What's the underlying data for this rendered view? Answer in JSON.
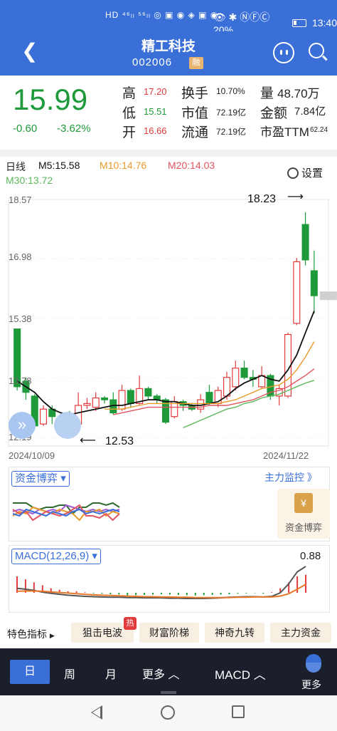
{
  "status_bar": {
    "left_text": "HD ⁴⁶ₗₗ ⁵⁶ₗₗ ◎ ▣ ◉ ◈ ▣ ◉ ·",
    "right_text": "👁 ✱ ⓃⒻⒸ 20%",
    "battery": "20%",
    "time": "13:40"
  },
  "header": {
    "back_icon": "chevron-left-icon",
    "title": "精工科技",
    "code": "002006",
    "margin_badge": "融",
    "face_icon": "face-icon",
    "search_icon": "search-icon"
  },
  "quote": {
    "price": "15.99",
    "change": "-0.60",
    "change_pct": "-3.62%",
    "high_label": "高",
    "high": "17.20",
    "low_label": "低",
    "low": "15.51",
    "open_label": "开",
    "open": "16.66",
    "turnover_label": "换手",
    "turnover": "10.70%",
    "mktcap_label": "市值",
    "mktcap": "72.19亿",
    "float_label": "流通",
    "float_cap": "72.19亿",
    "volume_label": "量",
    "volume": "48.70万",
    "amount_label": "金额",
    "amount": "7.84亿",
    "pe_label": "市盈TTM",
    "pe": "62.24",
    "colors": {
      "up": "#e23b3b",
      "down": "#1e9a3a"
    }
  },
  "kline": {
    "period_label": "日线",
    "ma5": "M5:15.58",
    "ma10": "M10:14.76",
    "ma20": "M20:14.03",
    "ma30": "M30:13.72",
    "settings_label": "设置",
    "y_top": "18.57",
    "y_2": "16.98",
    "y_3": "15.38",
    "y_4": "13.78",
    "y_bottom": "12.19",
    "x_start": "2024/10/09",
    "x_end": "2024/11/22",
    "max_annotation": "18.23",
    "min_annotation": "12.53"
  },
  "capital": {
    "dropdown": "资金博弈",
    "monitor_link": "主力监控 》",
    "card_label": "资金博弈"
  },
  "macd": {
    "dropdown": "MACD(12,26,9)",
    "value": "0.88"
  },
  "chips": {
    "tese": "特色指标",
    "c1": "狙击电波",
    "hot": "热",
    "c2": "财富阶梯",
    "c3": "神奇九转",
    "c4": "主力资金"
  },
  "toolbar": {
    "day": "日",
    "week": "周",
    "month": "月",
    "more_period": "更多 ︿",
    "indicator": "MACD ︿",
    "more": "更多"
  },
  "chart_data": {
    "type": "candlestick",
    "y_range": [
      12.19,
      18.57
    ],
    "y_ticks": [
      18.57,
      16.98,
      15.38,
      13.78,
      12.19
    ],
    "x_labels": [
      "2024/10/09",
      "2024/11/22"
    ],
    "candles": [
      {
        "o": 15.1,
        "c": 13.55,
        "h": 15.1,
        "l": 13.45
      },
      {
        "o": 13.7,
        "c": 13.4,
        "h": 13.8,
        "l": 13.2
      },
      {
        "o": 13.3,
        "c": 12.5,
        "h": 13.35,
        "l": 12.45
      },
      {
        "o": 12.55,
        "c": 12.95,
        "h": 13.05,
        "l": 12.5
      },
      {
        "o": 12.95,
        "c": 12.75,
        "h": 13.05,
        "l": 12.55
      },
      {
        "o": 12.7,
        "c": 12.65,
        "h": 12.8,
        "l": 12.53
      },
      {
        "o": 12.7,
        "c": 12.55,
        "h": 12.9,
        "l": 12.45
      },
      {
        "o": 12.55,
        "c": 13.05,
        "h": 13.4,
        "l": 12.45
      },
      {
        "o": 13.05,
        "c": 13.1,
        "h": 13.25,
        "l": 12.95
      },
      {
        "o": 13.0,
        "c": 13.25,
        "h": 13.4,
        "l": 12.9
      },
      {
        "o": 13.25,
        "c": 13.2,
        "h": 13.3,
        "l": 13.1
      },
      {
        "o": 13.2,
        "c": 12.85,
        "h": 13.4,
        "l": 12.8
      },
      {
        "o": 12.95,
        "c": 13.45,
        "h": 13.6,
        "l": 12.9
      },
      {
        "o": 13.45,
        "c": 13.1,
        "h": 13.5,
        "l": 13.0
      },
      {
        "o": 13.1,
        "c": 13.5,
        "h": 13.85,
        "l": 13.05
      },
      {
        "o": 13.5,
        "c": 13.3,
        "h": 13.55,
        "l": 13.2
      },
      {
        "o": 13.3,
        "c": 13.2,
        "h": 13.35,
        "l": 13.1
      },
      {
        "o": 13.2,
        "c": 12.6,
        "h": 13.25,
        "l": 12.55
      },
      {
        "o": 12.75,
        "c": 13.15,
        "h": 13.3,
        "l": 12.7
      },
      {
        "o": 13.15,
        "c": 13.05,
        "h": 13.2,
        "l": 12.9
      },
      {
        "o": 13.05,
        "c": 12.95,
        "h": 13.1,
        "l": 12.9
      },
      {
        "o": 12.95,
        "c": 13.2,
        "h": 13.35,
        "l": 12.85
      },
      {
        "o": 13.4,
        "c": 13.1,
        "h": 13.6,
        "l": 13.05
      },
      {
        "o": 13.1,
        "c": 13.45,
        "h": 13.55,
        "l": 13.0
      },
      {
        "o": 13.3,
        "c": 13.8,
        "h": 13.95,
        "l": 13.2
      },
      {
        "o": 13.55,
        "c": 14.05,
        "h": 14.25,
        "l": 13.45
      },
      {
        "o": 14.05,
        "c": 13.8,
        "h": 14.25,
        "l": 13.75
      },
      {
        "o": 13.8,
        "c": 13.75,
        "h": 14.0,
        "l": 13.55
      },
      {
        "o": 13.55,
        "c": 13.85,
        "h": 14.1,
        "l": 13.5
      },
      {
        "o": 13.85,
        "c": 13.3,
        "h": 13.9,
        "l": 13.2
      },
      {
        "o": 13.3,
        "c": 13.5,
        "h": 13.6,
        "l": 13.05
      },
      {
        "o": 13.3,
        "c": 14.95,
        "h": 15.0,
        "l": 13.25
      },
      {
        "o": 15.25,
        "c": 16.9,
        "h": 17.0,
        "l": 15.2
      },
      {
        "o": 17.9,
        "c": 16.95,
        "h": 18.23,
        "l": 16.8
      },
      {
        "o": 16.66,
        "c": 15.99,
        "h": 17.2,
        "l": 15.51
      }
    ],
    "ma_lines": [
      {
        "name": "M5",
        "color": "#111111",
        "values": [
          13.7,
          13.55,
          13.4,
          13.15,
          12.95,
          12.85,
          12.8,
          12.85,
          12.9,
          12.95,
          13.0,
          13.05,
          13.05,
          13.1,
          13.15,
          13.2,
          13.2,
          13.15,
          13.15,
          13.1,
          13.05,
          13.05,
          13.1,
          13.15,
          13.3,
          13.5,
          13.65,
          13.75,
          13.85,
          13.75,
          13.7,
          14.0,
          14.4,
          15.0,
          15.58
        ]
      },
      {
        "name": "M10",
        "color": "#e89a2a",
        "values": [
          null,
          null,
          null,
          null,
          null,
          null,
          null,
          null,
          null,
          null,
          12.95,
          12.95,
          12.95,
          13.0,
          13.05,
          13.1,
          13.1,
          13.1,
          13.1,
          13.1,
          13.1,
          13.1,
          13.1,
          13.1,
          13.15,
          13.2,
          13.3,
          13.4,
          13.5,
          13.55,
          13.6,
          13.75,
          14.0,
          14.35,
          14.76
        ]
      },
      {
        "name": "M20",
        "color": "#e05560",
        "values": [
          null,
          null,
          null,
          null,
          null,
          null,
          null,
          null,
          null,
          null,
          null,
          12.8,
          12.85,
          12.9,
          12.95,
          13.0,
          13.0,
          13.0,
          13.0,
          13.0,
          13.0,
          13.0,
          13.05,
          13.05,
          13.05,
          13.1,
          13.15,
          13.2,
          13.3,
          13.4,
          13.45,
          13.55,
          13.7,
          13.85,
          14.03
        ]
      },
      {
        "name": "M30",
        "color": "#5cb85c",
        "values": [
          null,
          null,
          null,
          null,
          null,
          null,
          null,
          null,
          null,
          null,
          null,
          null,
          null,
          null,
          null,
          null,
          null,
          null,
          null,
          12.45,
          12.55,
          12.65,
          12.75,
          12.85,
          12.95,
          13.0,
          13.1,
          13.15,
          13.25,
          13.3,
          13.35,
          13.45,
          13.55,
          13.65,
          13.72
        ]
      }
    ],
    "capital_lines": [
      {
        "color": "#2e6b2e",
        "values": [
          0.3,
          0.3,
          0.3,
          0.4,
          0.45,
          0.4,
          0.4,
          0.35,
          0.35,
          0.55,
          0.4,
          0.4,
          0.3,
          0.3,
          0.35,
          0.3,
          0.4
        ]
      },
      {
        "color": "#a05bd6",
        "values": [
          0.5,
          0.45,
          0.5,
          0.55,
          0.45,
          0.5,
          0.45,
          0.5,
          0.35,
          0.4,
          0.45,
          0.5,
          0.45,
          0.5,
          0.45,
          0.5,
          0.45
        ]
      },
      {
        "color": "#e89a2a",
        "values": [
          0.6,
          0.5,
          0.55,
          0.4,
          0.45,
          0.5,
          0.55,
          0.45,
          0.5,
          0.55,
          0.7,
          0.5,
          0.5,
          0.45,
          0.6,
          0.5,
          0.55
        ]
      },
      {
        "color": "#e05560",
        "values": [
          0.45,
          0.55,
          0.5,
          0.7,
          0.6,
          0.5,
          0.55,
          0.6,
          0.55,
          0.45,
          0.35,
          0.6,
          0.6,
          0.65,
          0.55,
          0.7,
          0.55
        ]
      },
      {
        "color": "#3a6fd8",
        "values": [
          0.55,
          0.6,
          0.45,
          0.5,
          0.55,
          0.6,
          0.5,
          0.55,
          0.6,
          0.5,
          0.45,
          0.55,
          0.5,
          0.55,
          0.5,
          0.45,
          0.5
        ]
      }
    ],
    "macd_bars": [
      0.55,
      0.45,
      0.35,
      0.25,
      0.15,
      0.1,
      0.05,
      0.05,
      0.02,
      -0.02,
      -0.03,
      -0.05,
      -0.06,
      -0.08,
      -0.08,
      -0.07,
      -0.06,
      -0.05,
      -0.06,
      -0.07,
      -0.08,
      -0.09,
      -0.08,
      -0.07,
      -0.06,
      -0.05,
      -0.03,
      -0.02,
      -0.01,
      -0.03,
      0.02,
      0.15,
      0.35,
      0.55,
      0.6
    ],
    "macd_dif": [
      0.15,
      0.12,
      0.08,
      0.02,
      -0.02,
      -0.05,
      -0.08,
      -0.1,
      -0.12,
      -0.13,
      -0.14,
      -0.15,
      -0.15,
      -0.16,
      -0.16,
      -0.17,
      -0.17,
      -0.17,
      -0.18,
      -0.18,
      -0.19,
      -0.19,
      -0.19,
      -0.18,
      -0.17,
      -0.15,
      -0.14,
      -0.13,
      -0.13,
      -0.14,
      -0.12,
      0.0,
      0.3,
      0.7,
      0.88
    ],
    "macd_dea": [
      0.05,
      0.06,
      0.06,
      0.05,
      0.03,
      0.01,
      -0.01,
      -0.03,
      -0.05,
      -0.07,
      -0.08,
      -0.09,
      -0.1,
      -0.11,
      -0.12,
      -0.13,
      -0.13,
      -0.14,
      -0.14,
      -0.15,
      -0.15,
      -0.16,
      -0.16,
      -0.16,
      -0.16,
      -0.16,
      -0.15,
      -0.15,
      -0.14,
      -0.14,
      -0.14,
      -0.11,
      -0.03,
      0.12,
      0.28
    ]
  }
}
